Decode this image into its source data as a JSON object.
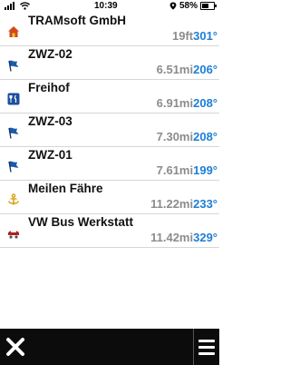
{
  "status_bar": {
    "time": "10:39",
    "battery": "58%",
    "battery_level": 0.58,
    "icons": [
      "signal-icon",
      "wifi-icon",
      "gps-icon",
      "battery-icon"
    ]
  },
  "waypoints": [
    {
      "name": "TRAMsoft GmbH",
      "distance": "19ft",
      "bearing": "301°",
      "icon": "home-icon",
      "icon_color": "#d04a1c"
    },
    {
      "name": "ZWZ-02",
      "distance": "6.51mi",
      "bearing": "206°",
      "icon": "flag-icon",
      "icon_color": "#1c5aa8"
    },
    {
      "name": "Freihof",
      "distance": "6.91mi",
      "bearing": "208°",
      "icon": "restaurant-icon",
      "icon_color": "#1c4f9c"
    },
    {
      "name": "ZWZ-03",
      "distance": "7.30mi",
      "bearing": "208°",
      "icon": "flag-icon",
      "icon_color": "#1c5aa8"
    },
    {
      "name": "ZWZ-01",
      "distance": "7.61mi",
      "bearing": "199°",
      "icon": "flag-icon",
      "icon_color": "#1c5aa8"
    },
    {
      "name": "Meilen Fähre",
      "distance": "11.22mi",
      "bearing": "233°",
      "icon": "anchor-icon",
      "icon_color": "#d8a21a"
    },
    {
      "name": "VW Bus Werkstatt",
      "distance": "11.42mi",
      "bearing": "329°",
      "icon": "car-repair-icon",
      "icon_color": "#b02020"
    }
  ],
  "colors": {
    "bearing": "#1e7ed6",
    "distance": "#8c8c8c",
    "bottom_bar": "#0c0c0c"
  },
  "bottom_bar": {
    "close_icon": "close-icon",
    "menu_icon": "menu-icon"
  }
}
